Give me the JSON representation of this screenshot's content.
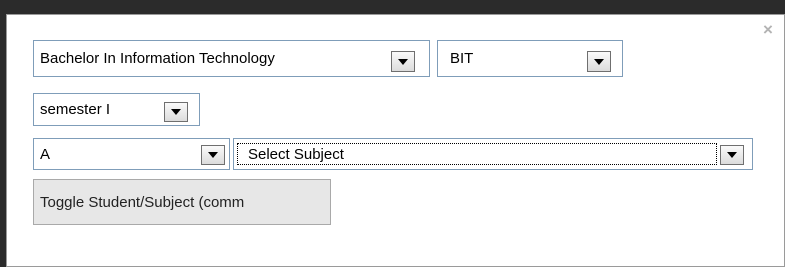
{
  "dialog": {
    "close_symbol": "×"
  },
  "selects": {
    "program": {
      "value": "Bachelor In Information Technology"
    },
    "program_code": {
      "value": "BIT"
    },
    "semester": {
      "value": "semester I"
    },
    "section": {
      "value": "A"
    },
    "subject": {
      "value": "Select Subject"
    }
  },
  "buttons": {
    "toggle_label": "Toggle Student/Subject (comm"
  },
  "icons": {
    "dropdown": "chevron-down-icon",
    "close": "close-icon"
  },
  "colors": {
    "select_border": "#7f9db9",
    "button_bg": "#e7e7e7"
  }
}
